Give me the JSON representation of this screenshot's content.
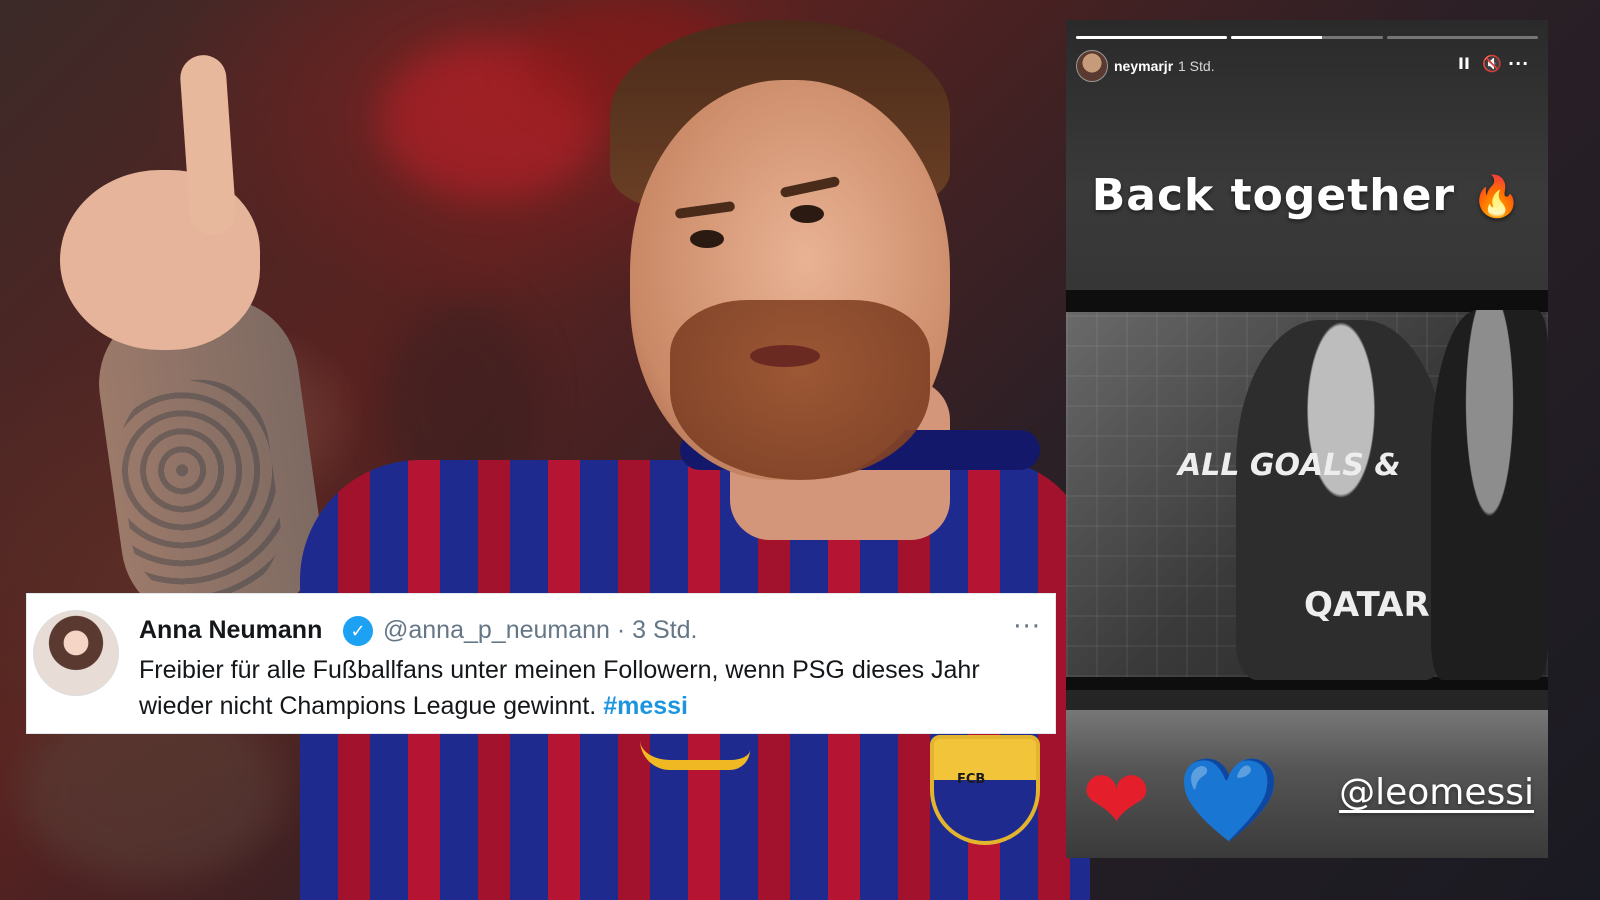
{
  "tweet": {
    "name": "Anna Neumann",
    "verified_glyph": "✓",
    "handle_time": "@anna_p_neumann · 3 Std.",
    "more": "···",
    "text": "Freibier für alle Fußballfans unter meinen Followern, wenn PSG dieses Jahr wieder nicht Champions League gewinnt. ",
    "hashtag": "#messi"
  },
  "story": {
    "username": "neymarjr",
    "time": "1 Std.",
    "pause": "II",
    "mute": "🔇",
    "more": "···",
    "caption": "Back together",
    "caption_emoji": "🔥",
    "screen_title": "ALL GOALS &",
    "jersey_text": "QATAR",
    "hearts": [
      "❤",
      "💙"
    ],
    "mention": "@leomessi",
    "progress": [
      1.0,
      0.6,
      0.0
    ]
  },
  "background": {
    "crest_text": "FCB"
  }
}
